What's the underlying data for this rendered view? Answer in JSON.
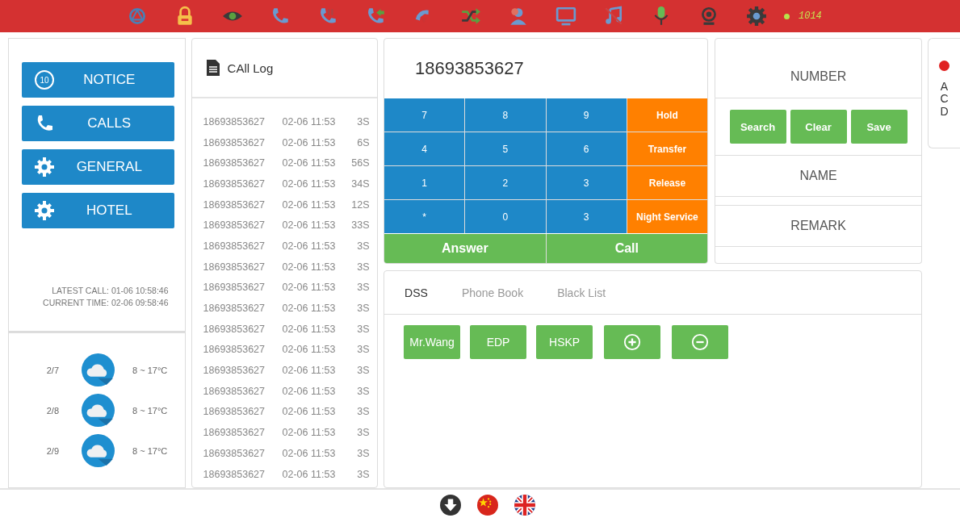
{
  "top_bar": {
    "status": {
      "online": true,
      "extension": "1014"
    }
  },
  "menu": [
    {
      "kind": "notice",
      "label": "NOTICE",
      "badge": "10"
    },
    {
      "kind": "calls",
      "label": "CALLS"
    },
    {
      "kind": "settings",
      "label": "GENERAL"
    },
    {
      "kind": "settings",
      "label": "HOTEL"
    }
  ],
  "latest_call": "LATEST CALL:  01-06 10:58:46",
  "current_time": "CURRENT TIME:  02-06 09:58:46",
  "weather": [
    {
      "date": "2/7",
      "temp": "8 ~ 17°C"
    },
    {
      "date": "2/8",
      "temp": "8 ~ 17°C"
    },
    {
      "date": "2/9",
      "temp": "8 ~ 17°C"
    }
  ],
  "call_log": {
    "title": "CAll Log",
    "rows": [
      {
        "number": "18693853627",
        "time": "02-06 11:53",
        "duration": "3S"
      },
      {
        "number": "18693853627",
        "time": "02-06 11:53",
        "duration": "6S"
      },
      {
        "number": "18693853627",
        "time": "02-06 11:53",
        "duration": "56S"
      },
      {
        "number": "18693853627",
        "time": "02-06 11:53",
        "duration": "34S"
      },
      {
        "number": "18693853627",
        "time": "02-06 11:53",
        "duration": "12S"
      },
      {
        "number": "18693853627",
        "time": "02-06 11:53",
        "duration": "33S"
      },
      {
        "number": "18693853627",
        "time": "02-06 11:53",
        "duration": "3S"
      },
      {
        "number": "18693853627",
        "time": "02-06 11:53",
        "duration": "3S"
      },
      {
        "number": "18693853627",
        "time": "02-06 11:53",
        "duration": "3S"
      },
      {
        "number": "18693853627",
        "time": "02-06 11:53",
        "duration": "3S"
      },
      {
        "number": "18693853627",
        "time": "02-06 11:53",
        "duration": "3S"
      },
      {
        "number": "18693853627",
        "time": "02-06 11:53",
        "duration": "3S"
      },
      {
        "number": "18693853627",
        "time": "02-06 11:53",
        "duration": "3S"
      },
      {
        "number": "18693853627",
        "time": "02-06 11:53",
        "duration": "3S"
      },
      {
        "number": "18693853627",
        "time": "02-06 11:53",
        "duration": "3S"
      },
      {
        "number": "18693853627",
        "time": "02-06 11:53",
        "duration": "3S"
      },
      {
        "number": "18693853627",
        "time": "02-06 11:53",
        "duration": "3S"
      },
      {
        "number": "18693853627",
        "time": "02-06 11:53",
        "duration": "3S"
      }
    ]
  },
  "dialer": {
    "number": "18693853627",
    "keys": [
      {
        "kind": "digit",
        "label": "7"
      },
      {
        "kind": "digit",
        "label": "8"
      },
      {
        "kind": "digit",
        "label": "9"
      },
      {
        "kind": "action",
        "label": "Hold"
      },
      {
        "kind": "digit",
        "label": "4"
      },
      {
        "kind": "digit",
        "label": "5"
      },
      {
        "kind": "digit",
        "label": "6"
      },
      {
        "kind": "action",
        "label": "Transfer"
      },
      {
        "kind": "digit",
        "label": "1"
      },
      {
        "kind": "digit",
        "label": "2"
      },
      {
        "kind": "digit",
        "label": "3"
      },
      {
        "kind": "action",
        "label": "Release"
      },
      {
        "kind": "digit",
        "label": "*"
      },
      {
        "kind": "digit",
        "label": "0"
      },
      {
        "kind": "digit",
        "label": "3"
      },
      {
        "kind": "action",
        "label": "Night Service"
      }
    ],
    "buttons": [
      "Answer",
      "Call"
    ]
  },
  "contact": {
    "number_placeholder": "NUMBER",
    "buttons": [
      "Search",
      "Clear",
      "Save"
    ],
    "name_placeholder": "NAME",
    "remark_placeholder": "REMARK"
  },
  "acd": {
    "label": "ACD",
    "color": "#e02020"
  },
  "tabs": [
    {
      "label": "DSS",
      "selected": true
    },
    {
      "label": "Phone Book",
      "selected": false
    },
    {
      "label": "Black List",
      "selected": false
    }
  ],
  "dss": [
    {
      "kind": "text",
      "label": "Mr.Wang"
    },
    {
      "kind": "text",
      "label": "EDP"
    },
    {
      "kind": "text",
      "label": "HSKP"
    },
    {
      "kind": "add"
    },
    {
      "kind": "remove"
    }
  ]
}
